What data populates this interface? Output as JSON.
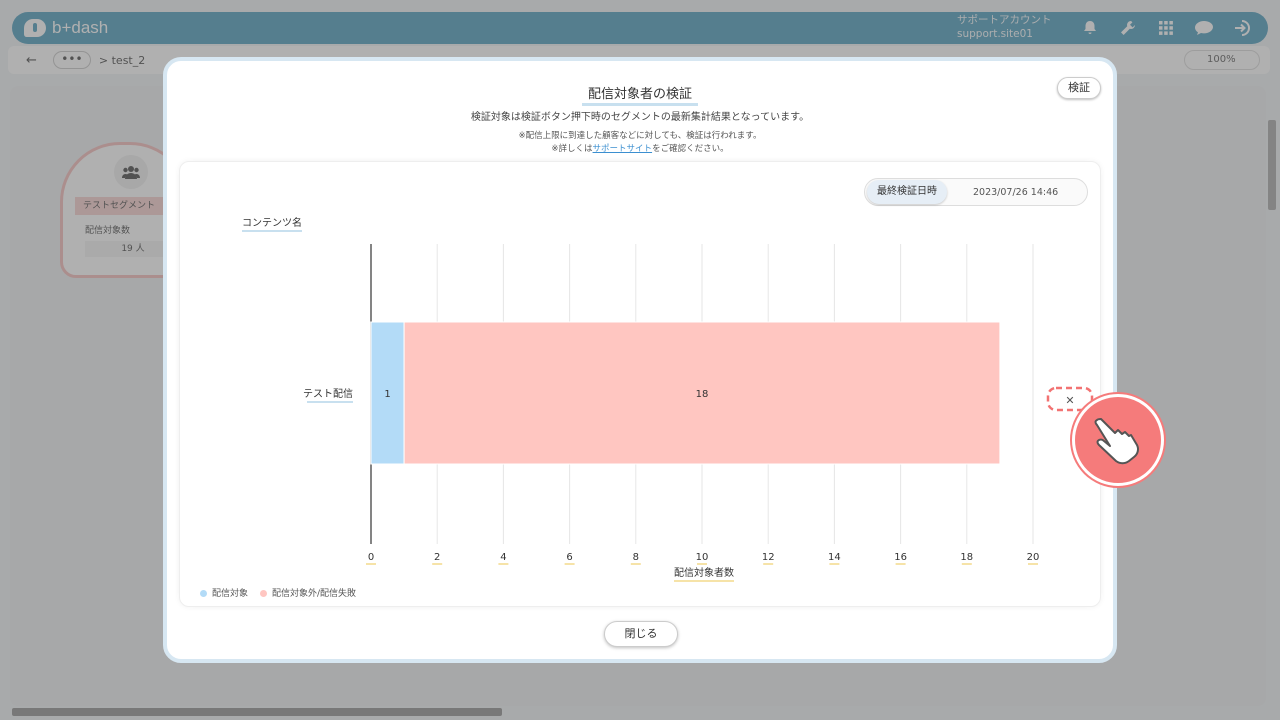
{
  "app": {
    "logo_text": "b+dash",
    "account_label": "サポートアカウント",
    "account_id": "support.site01"
  },
  "subbar": {
    "back": "←",
    "dots": "•••",
    "breadcrumb": "> test_2",
    "zoom": "100%"
  },
  "segment_card": {
    "title": "テストセグメント",
    "sub_label": "配信対象数",
    "count": "19 人"
  },
  "modal": {
    "title": "配信対象者の検証",
    "verify_button": "検証",
    "description": "検証対象は検証ボタン押下時のセグメントの最新集計結果となっています。",
    "note1": "※配信上限に到達した顧客などに対しても、検証は行われます。",
    "note2_prefix": "※詳しくは",
    "note2_link": "サポートサイト",
    "note2_suffix": "をご確認ください。",
    "last_verified_label": "最終検証日時",
    "last_verified_value": "2023/07/26 14:46",
    "close_button": "閉じる"
  },
  "chart_data": {
    "type": "bar",
    "orientation": "horizontal",
    "stacked": true,
    "categories": [
      "テスト配信"
    ],
    "series": [
      {
        "name": "配信対象",
        "values": [
          1
        ],
        "color": "#b3dbf7"
      },
      {
        "name": "配信対象外/配信失敗",
        "values": [
          18
        ],
        "color": "#ffc6c1"
      }
    ],
    "xlabel": "配信対象者数",
    "ylabel": "コンテンツ名",
    "xlim": [
      0,
      20
    ],
    "xticks": [
      0,
      2,
      4,
      6,
      8,
      10,
      12,
      14,
      16,
      18,
      20
    ],
    "grid": true,
    "legend_position": "bottom-left"
  },
  "colors": {
    "brand": "#5aa4c2",
    "accent_pink": "#f57b7b"
  }
}
